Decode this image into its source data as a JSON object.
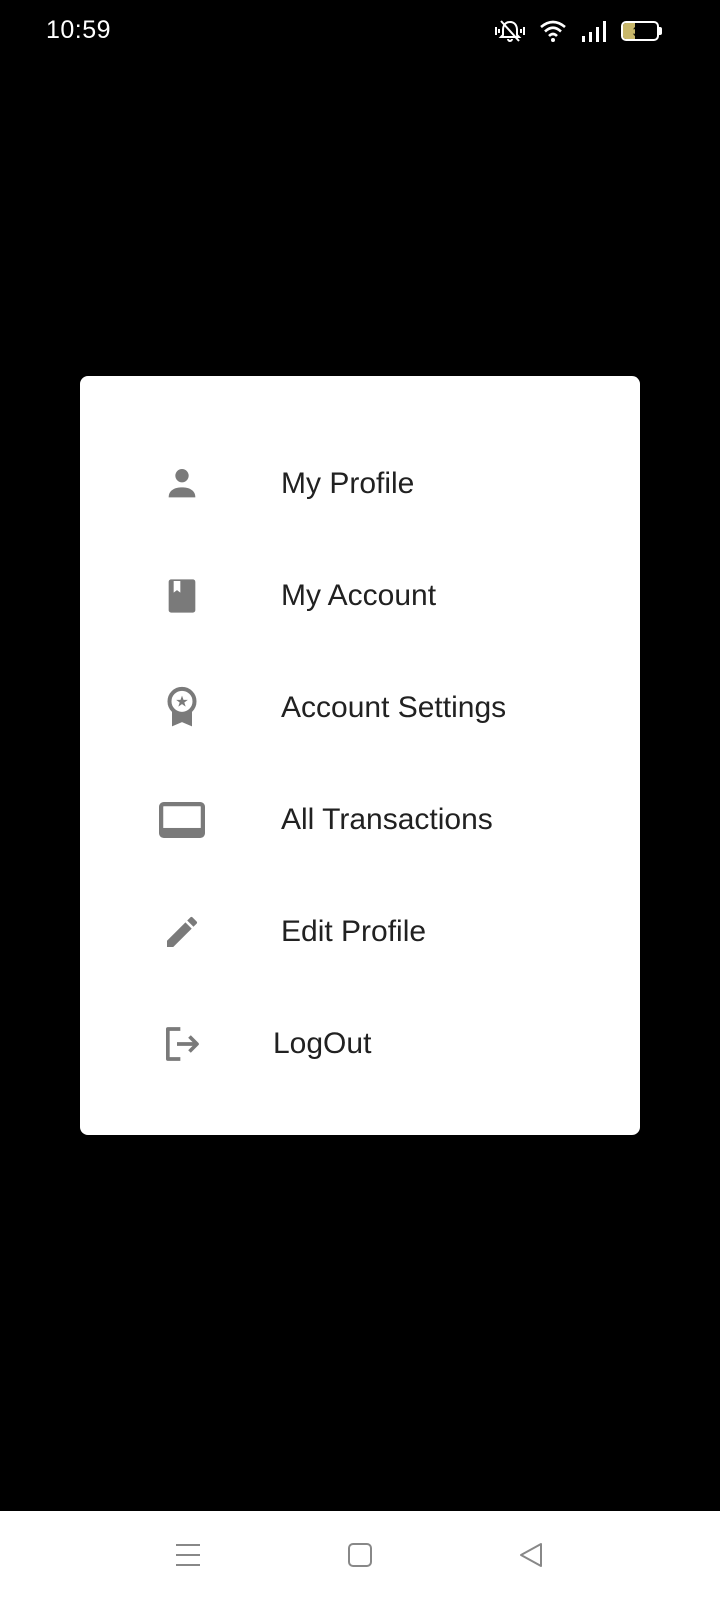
{
  "status_bar": {
    "time": "10:59",
    "battery_level": "35",
    "battery_fraction": 0.35,
    "icons": [
      "mute-vibrate-icon",
      "wifi-icon",
      "signal-icon",
      "battery-icon"
    ]
  },
  "menu": {
    "items": [
      {
        "label": "My Profile",
        "icon": "person-icon"
      },
      {
        "label": "My Account",
        "icon": "book-icon"
      },
      {
        "label": "Account Settings",
        "icon": "badge-icon"
      },
      {
        "label": "All Transactions",
        "icon": "laptop-icon"
      },
      {
        "label": "Edit Profile",
        "icon": "pencil-icon"
      },
      {
        "label": "LogOut",
        "icon": "logout-icon"
      }
    ]
  },
  "nav_bar": {
    "buttons": [
      "menu-icon",
      "home-icon",
      "back-icon"
    ]
  },
  "colors": {
    "background": "#000000",
    "card": "#ffffff",
    "icon": "#7a7a7a",
    "text": "#212121"
  }
}
